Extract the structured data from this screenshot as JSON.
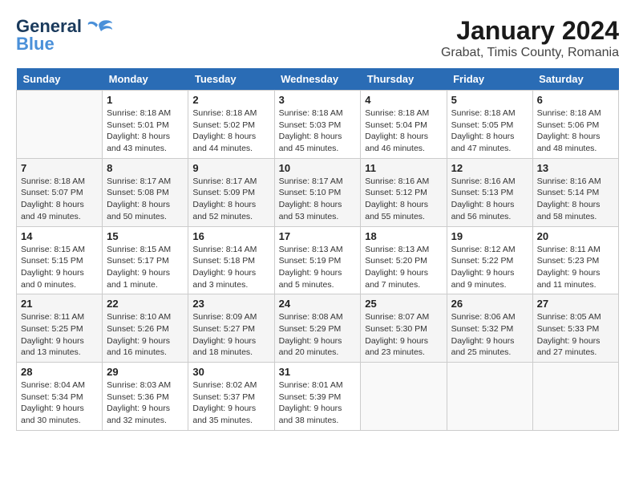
{
  "logo": {
    "line1": "General",
    "line2": "Blue"
  },
  "title": "January 2024",
  "subtitle": "Grabat, Timis County, Romania",
  "headers": [
    "Sunday",
    "Monday",
    "Tuesday",
    "Wednesday",
    "Thursday",
    "Friday",
    "Saturday"
  ],
  "weeks": [
    [
      {
        "day": "",
        "info": ""
      },
      {
        "day": "1",
        "info": "Sunrise: 8:18 AM\nSunset: 5:01 PM\nDaylight: 8 hours\nand 43 minutes."
      },
      {
        "day": "2",
        "info": "Sunrise: 8:18 AM\nSunset: 5:02 PM\nDaylight: 8 hours\nand 44 minutes."
      },
      {
        "day": "3",
        "info": "Sunrise: 8:18 AM\nSunset: 5:03 PM\nDaylight: 8 hours\nand 45 minutes."
      },
      {
        "day": "4",
        "info": "Sunrise: 8:18 AM\nSunset: 5:04 PM\nDaylight: 8 hours\nand 46 minutes."
      },
      {
        "day": "5",
        "info": "Sunrise: 8:18 AM\nSunset: 5:05 PM\nDaylight: 8 hours\nand 47 minutes."
      },
      {
        "day": "6",
        "info": "Sunrise: 8:18 AM\nSunset: 5:06 PM\nDaylight: 8 hours\nand 48 minutes."
      }
    ],
    [
      {
        "day": "7",
        "info": "Sunrise: 8:18 AM\nSunset: 5:07 PM\nDaylight: 8 hours\nand 49 minutes."
      },
      {
        "day": "8",
        "info": "Sunrise: 8:17 AM\nSunset: 5:08 PM\nDaylight: 8 hours\nand 50 minutes."
      },
      {
        "day": "9",
        "info": "Sunrise: 8:17 AM\nSunset: 5:09 PM\nDaylight: 8 hours\nand 52 minutes."
      },
      {
        "day": "10",
        "info": "Sunrise: 8:17 AM\nSunset: 5:10 PM\nDaylight: 8 hours\nand 53 minutes."
      },
      {
        "day": "11",
        "info": "Sunrise: 8:16 AM\nSunset: 5:12 PM\nDaylight: 8 hours\nand 55 minutes."
      },
      {
        "day": "12",
        "info": "Sunrise: 8:16 AM\nSunset: 5:13 PM\nDaylight: 8 hours\nand 56 minutes."
      },
      {
        "day": "13",
        "info": "Sunrise: 8:16 AM\nSunset: 5:14 PM\nDaylight: 8 hours\nand 58 minutes."
      }
    ],
    [
      {
        "day": "14",
        "info": "Sunrise: 8:15 AM\nSunset: 5:15 PM\nDaylight: 9 hours\nand 0 minutes."
      },
      {
        "day": "15",
        "info": "Sunrise: 8:15 AM\nSunset: 5:17 PM\nDaylight: 9 hours\nand 1 minute."
      },
      {
        "day": "16",
        "info": "Sunrise: 8:14 AM\nSunset: 5:18 PM\nDaylight: 9 hours\nand 3 minutes."
      },
      {
        "day": "17",
        "info": "Sunrise: 8:13 AM\nSunset: 5:19 PM\nDaylight: 9 hours\nand 5 minutes."
      },
      {
        "day": "18",
        "info": "Sunrise: 8:13 AM\nSunset: 5:20 PM\nDaylight: 9 hours\nand 7 minutes."
      },
      {
        "day": "19",
        "info": "Sunrise: 8:12 AM\nSunset: 5:22 PM\nDaylight: 9 hours\nand 9 minutes."
      },
      {
        "day": "20",
        "info": "Sunrise: 8:11 AM\nSunset: 5:23 PM\nDaylight: 9 hours\nand 11 minutes."
      }
    ],
    [
      {
        "day": "21",
        "info": "Sunrise: 8:11 AM\nSunset: 5:25 PM\nDaylight: 9 hours\nand 13 minutes."
      },
      {
        "day": "22",
        "info": "Sunrise: 8:10 AM\nSunset: 5:26 PM\nDaylight: 9 hours\nand 16 minutes."
      },
      {
        "day": "23",
        "info": "Sunrise: 8:09 AM\nSunset: 5:27 PM\nDaylight: 9 hours\nand 18 minutes."
      },
      {
        "day": "24",
        "info": "Sunrise: 8:08 AM\nSunset: 5:29 PM\nDaylight: 9 hours\nand 20 minutes."
      },
      {
        "day": "25",
        "info": "Sunrise: 8:07 AM\nSunset: 5:30 PM\nDaylight: 9 hours\nand 23 minutes."
      },
      {
        "day": "26",
        "info": "Sunrise: 8:06 AM\nSunset: 5:32 PM\nDaylight: 9 hours\nand 25 minutes."
      },
      {
        "day": "27",
        "info": "Sunrise: 8:05 AM\nSunset: 5:33 PM\nDaylight: 9 hours\nand 27 minutes."
      }
    ],
    [
      {
        "day": "28",
        "info": "Sunrise: 8:04 AM\nSunset: 5:34 PM\nDaylight: 9 hours\nand 30 minutes."
      },
      {
        "day": "29",
        "info": "Sunrise: 8:03 AM\nSunset: 5:36 PM\nDaylight: 9 hours\nand 32 minutes."
      },
      {
        "day": "30",
        "info": "Sunrise: 8:02 AM\nSunset: 5:37 PM\nDaylight: 9 hours\nand 35 minutes."
      },
      {
        "day": "31",
        "info": "Sunrise: 8:01 AM\nSunset: 5:39 PM\nDaylight: 9 hours\nand 38 minutes."
      },
      {
        "day": "",
        "info": ""
      },
      {
        "day": "",
        "info": ""
      },
      {
        "day": "",
        "info": ""
      }
    ]
  ]
}
